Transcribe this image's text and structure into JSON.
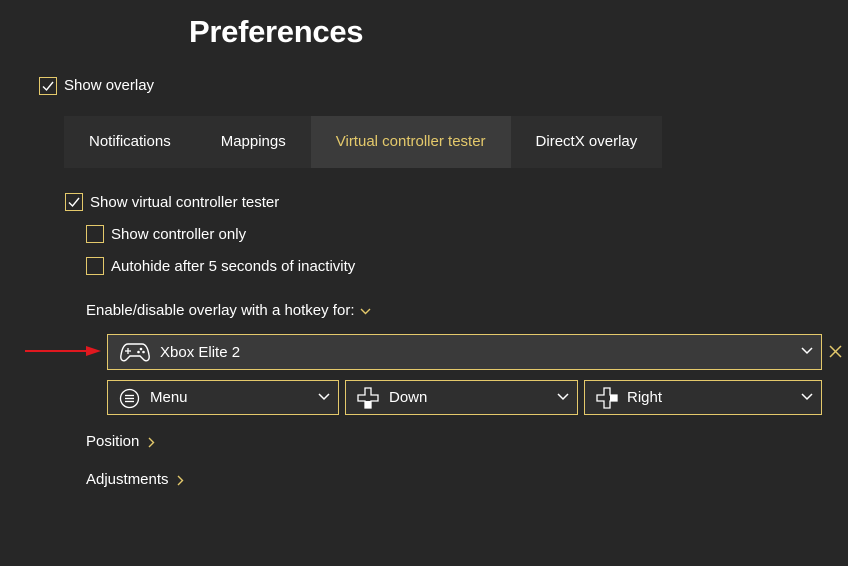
{
  "page": {
    "title": "Preferences"
  },
  "overlay": {
    "label": "Show overlay",
    "checked": true
  },
  "tabs": [
    {
      "label": "Notifications",
      "active": false
    },
    {
      "label": "Mappings",
      "active": false
    },
    {
      "label": "Virtual controller tester",
      "active": true
    },
    {
      "label": "DirectX overlay",
      "active": false
    }
  ],
  "options": {
    "show_tester": {
      "label": "Show virtual controller tester",
      "checked": true
    },
    "controller_only": {
      "label": "Show controller only",
      "checked": false
    },
    "autohide": {
      "label": "Autohide after 5 seconds of inactivity",
      "checked": false
    }
  },
  "hotkey": {
    "label": "Enable/disable overlay with a hotkey for:",
    "controller": "Xbox Elite 2",
    "buttons": [
      {
        "value": "Menu",
        "icon": "menu-button-icon"
      },
      {
        "value": "Down",
        "icon": "dpad-down-icon"
      },
      {
        "value": "Right",
        "icon": "dpad-right-icon"
      }
    ]
  },
  "sections": {
    "position": "Position",
    "adjustments": "Adjustments"
  },
  "colors": {
    "accent": "#e4c96b",
    "background": "#272727",
    "arrow": "#e0181f"
  }
}
